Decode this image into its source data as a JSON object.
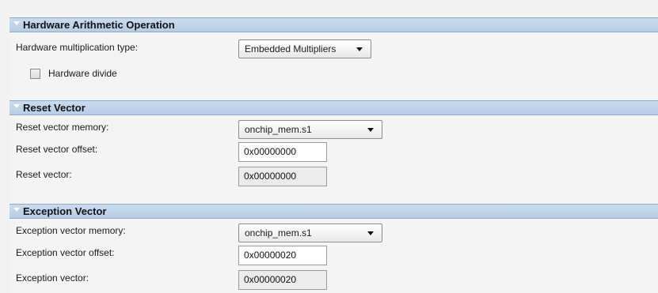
{
  "sections": {
    "hardware_arithmetic": {
      "title": "Hardware Arithmetic Operation",
      "multiplication_type_label": "Hardware multiplication type:",
      "multiplication_type_value": "Embedded Multipliers",
      "hardware_divide_label": "Hardware divide",
      "hardware_divide_checked": false
    },
    "reset_vector": {
      "title": "Reset Vector",
      "memory_label": "Reset vector memory:",
      "memory_value": "onchip_mem.s1",
      "offset_label": "Reset vector offset:",
      "offset_value": "0x00000000",
      "vector_label": "Reset vector:",
      "vector_value": "0x00000000"
    },
    "exception_vector": {
      "title": "Exception Vector",
      "memory_label": "Exception vector memory:",
      "memory_value": "onchip_mem.s1",
      "offset_label": "Exception vector offset:",
      "offset_value": "0x00000020",
      "vector_label": "Exception vector:",
      "vector_value": "0x00000020"
    }
  },
  "icons": {
    "section_collapse": "triangle-down-icon",
    "dropdown": "chevron-down-icon"
  },
  "colors": {
    "section_header_bg": "#bcd2ea",
    "panel_bg": "#f4f4f4",
    "readonly_field_bg": "#ececec"
  }
}
